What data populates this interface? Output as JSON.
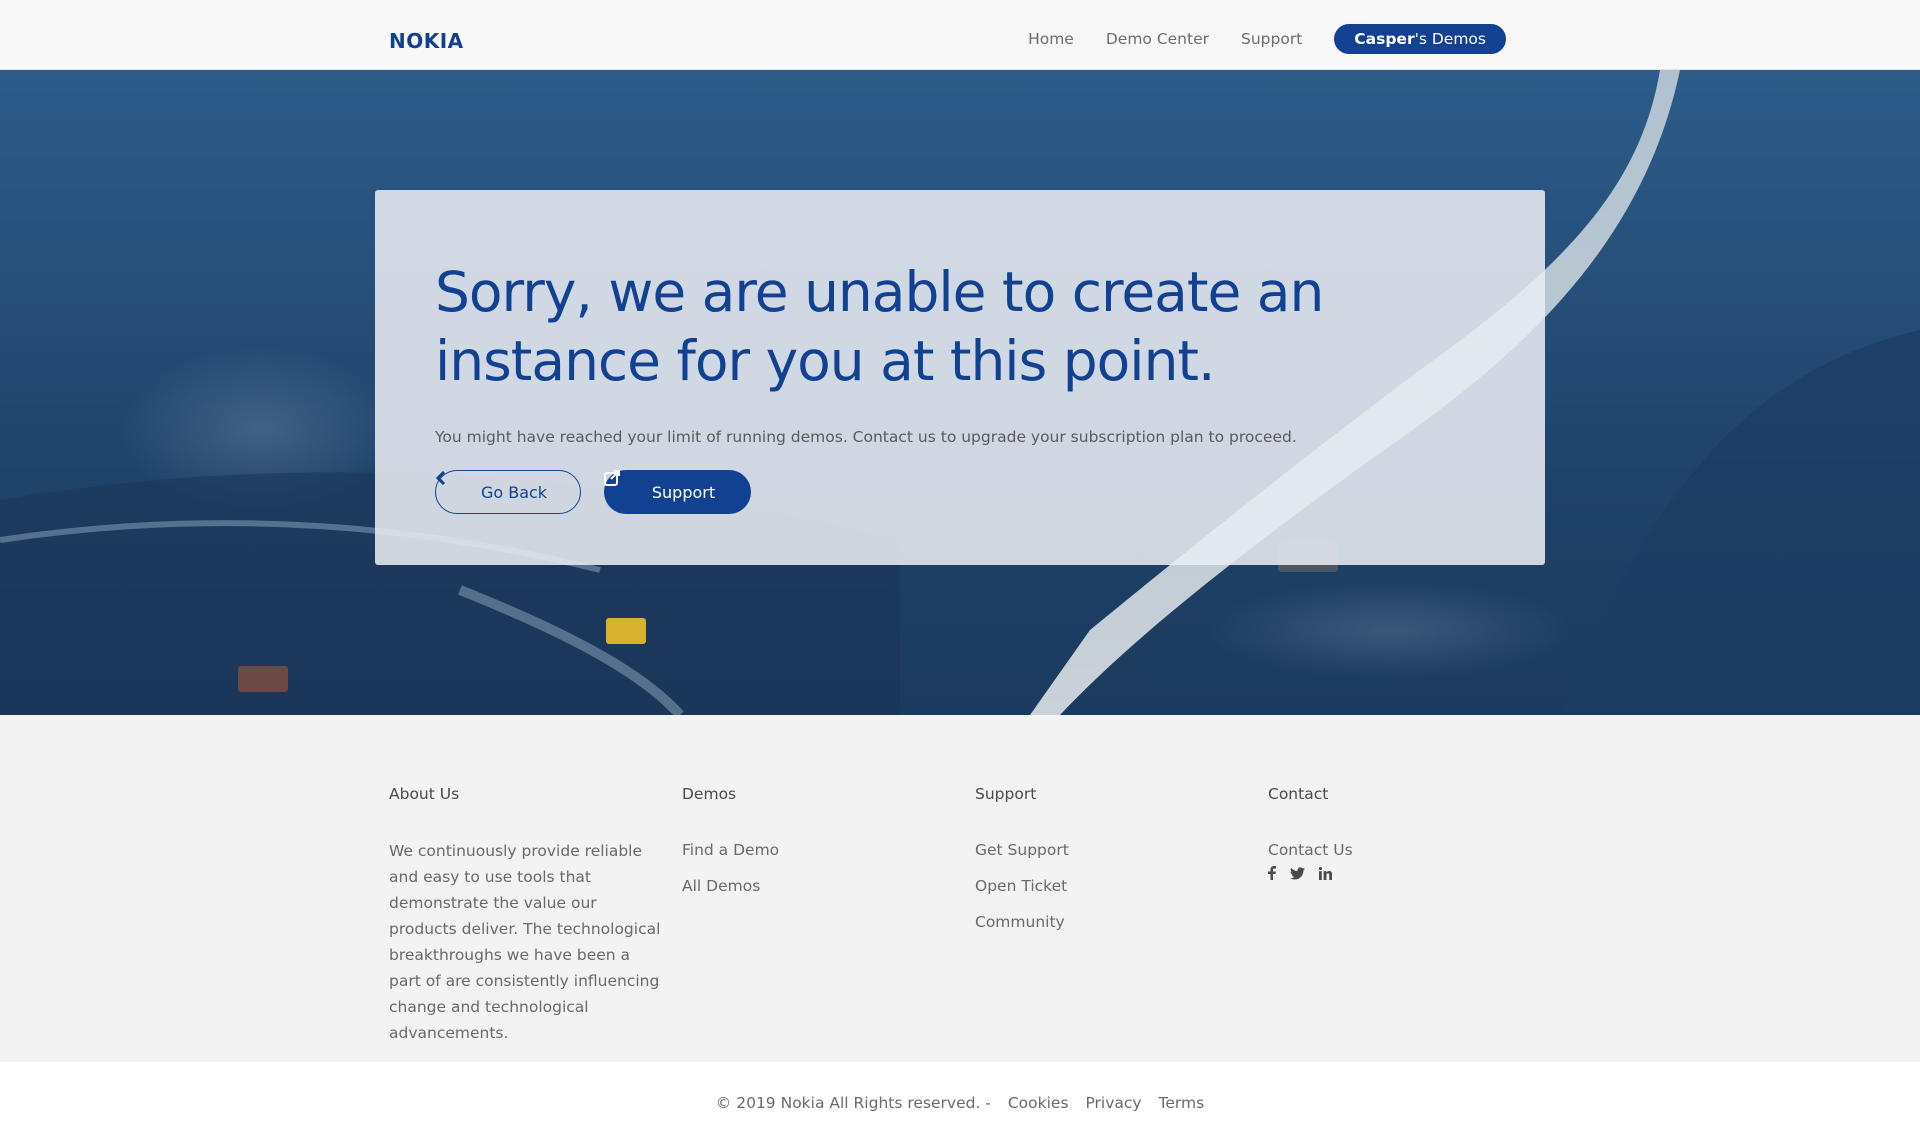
{
  "header": {
    "logo": "NOKIA",
    "nav": [
      "Home",
      "Demo Center",
      "Support"
    ],
    "user_name": "Casper",
    "user_suffix": "'s Demos"
  },
  "hero": {
    "title": "Sorry, we are unable to create an instance for you at this point.",
    "message": "You might have reached your limit of running demos. Contact us to upgrade your subscription plan to proceed.",
    "back_label": "Go Back",
    "support_label": "Support",
    "back_icon": "chevron-left-icon",
    "support_icon": "external-link-icon"
  },
  "footer": {
    "about": {
      "heading": "About Us",
      "text": "We continuously provide reliable and easy to use tools that demonstrate the value our products deliver. The technological breakthroughs we have been a part of are consistently influencing change and technological advancements."
    },
    "demos": {
      "heading": "Demos",
      "links": [
        "Find a Demo",
        "All Demos"
      ]
    },
    "support": {
      "heading": "Support",
      "links": [
        "Get Support",
        "Open Ticket",
        "Community"
      ]
    },
    "contact": {
      "heading": "Contact",
      "links": [
        "Contact Us"
      ],
      "social_icons": [
        "facebook-icon",
        "twitter-icon",
        "linkedin-icon"
      ]
    }
  },
  "bottom": {
    "copyright": "© 2019 Nokia All Rights reserved. -",
    "links": [
      "Cookies",
      "Privacy",
      "Terms"
    ]
  },
  "colors": {
    "brand": "#124191",
    "header_bg": "#f8f8f8",
    "footer_bg": "#f3f3f3"
  }
}
